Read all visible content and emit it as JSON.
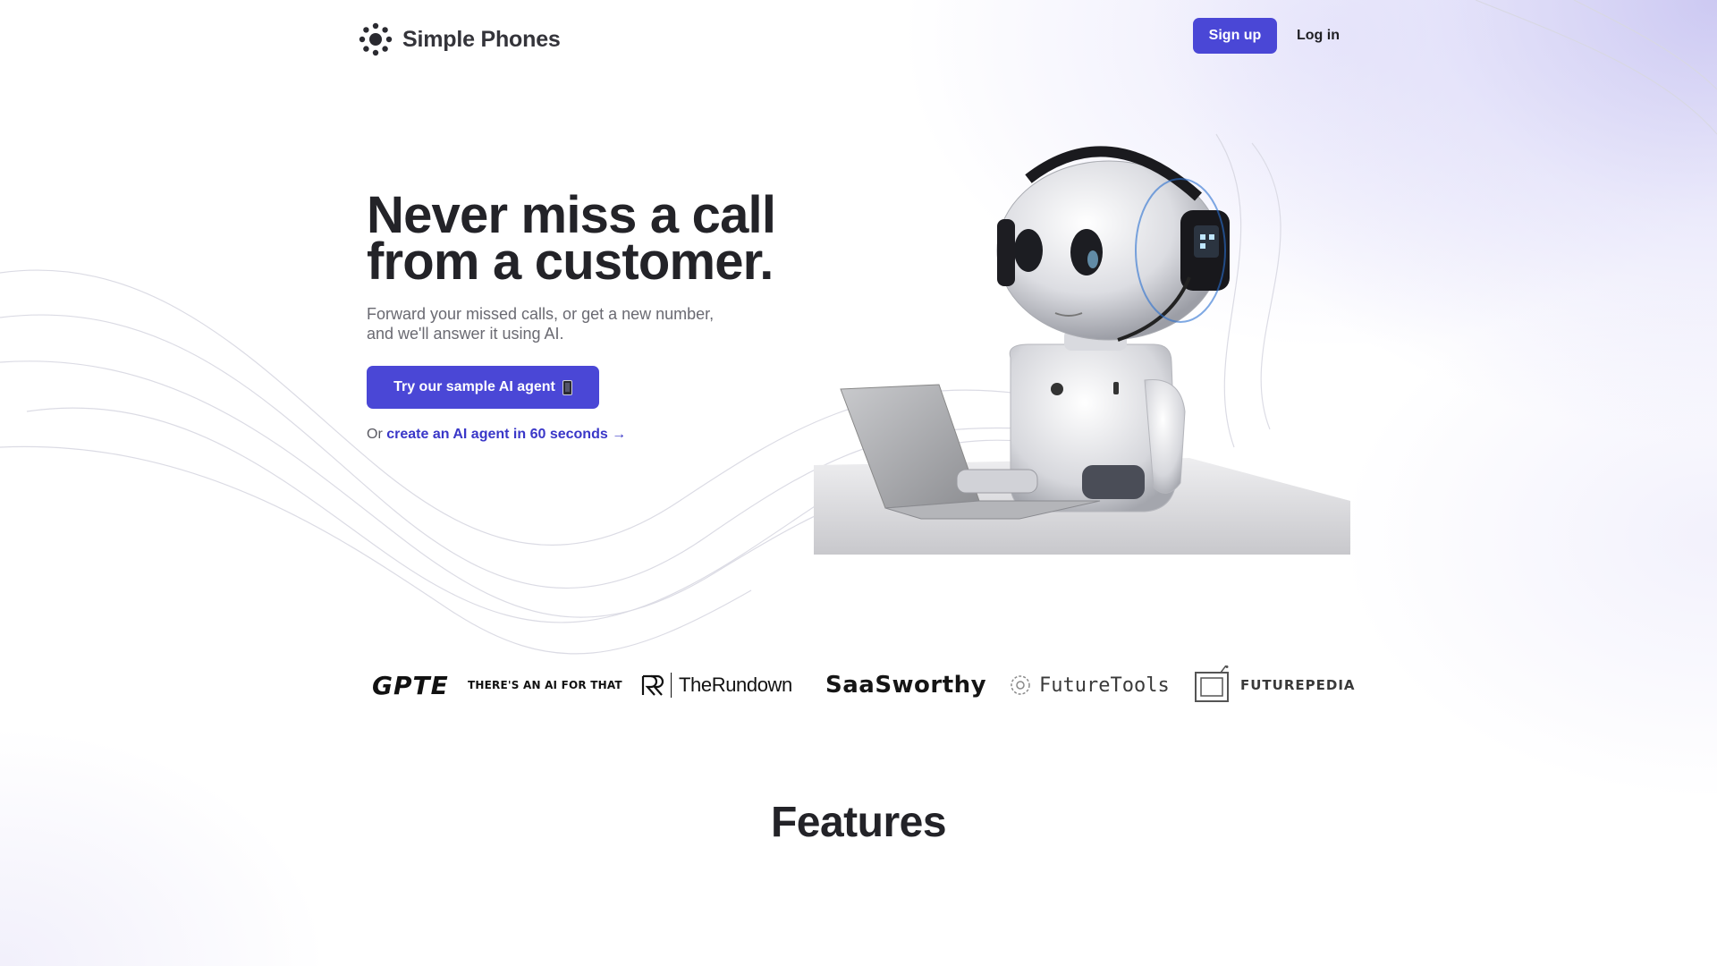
{
  "header": {
    "brand_name": "Simple Phones",
    "brand_icon": "sunburst-logo-icon",
    "signup_label": "Sign up",
    "login_label": "Log in",
    "accent_color": "#4a47d6"
  },
  "hero": {
    "title_lines": [
      "Never miss a call",
      "from a customer."
    ],
    "subtitle_lines": [
      "Forward your missed calls, or get a new number,",
      "and we'll answer it using AI."
    ],
    "cta_label": "Try our sample AI agent",
    "cta_icon": "mobile-phone-icon",
    "secondary_prefix": "Or",
    "secondary_link": "create an AI agent in 60 seconds →",
    "illustration": "robot-with-headset-at-laptop"
  },
  "featured_logos": [
    {
      "name": "GPTE",
      "text": "GPTE"
    },
    {
      "name": "There's an AI for that",
      "text": "THERE'S AN AI FOR THAT"
    },
    {
      "name": "The Rundown",
      "text": "TheRundown"
    },
    {
      "name": "SaaSworthy",
      "text": "SaaSworthy"
    },
    {
      "name": "FutureTools",
      "text": "FutureTools"
    },
    {
      "name": "Futurepedia",
      "text": "FUTUREPEDIA"
    }
  ],
  "features": {
    "title": "Features"
  }
}
